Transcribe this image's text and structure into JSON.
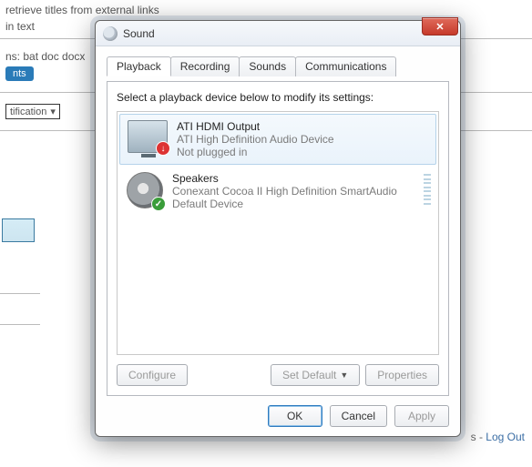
{
  "background": {
    "line1": "retrieve titles from external links",
    "line2": "in text",
    "ext_label": "ns: bat doc docx",
    "ext_btn": "nts",
    "select_value": "tification",
    "footer_sep": "s - ",
    "footer_link": "Log Out"
  },
  "dialog": {
    "title": "Sound",
    "close_glyph": "✕",
    "tabs": [
      {
        "label": "Playback",
        "active": true
      },
      {
        "label": "Recording",
        "active": false
      },
      {
        "label": "Sounds",
        "active": false
      },
      {
        "label": "Communications",
        "active": false
      }
    ],
    "instruction": "Select a playback device below to modify its settings:",
    "devices": [
      {
        "name": "ATI HDMI Output",
        "desc": "ATI High Definition Audio Device",
        "status": "Not plugged in",
        "selected": true,
        "icon": "monitor",
        "overlay": "down",
        "overlay_glyph": "↓",
        "meter": false
      },
      {
        "name": "Speakers",
        "desc": "Conexant Cocoa II High Definition SmartAudio",
        "status": "Default Device",
        "selected": false,
        "icon": "speaker",
        "overlay": "ok",
        "overlay_glyph": "✓",
        "meter": true
      }
    ],
    "buttons": {
      "configure": "Configure",
      "setdefault": "Set Default",
      "properties": "Properties",
      "ok": "OK",
      "cancel": "Cancel",
      "apply": "Apply"
    }
  }
}
